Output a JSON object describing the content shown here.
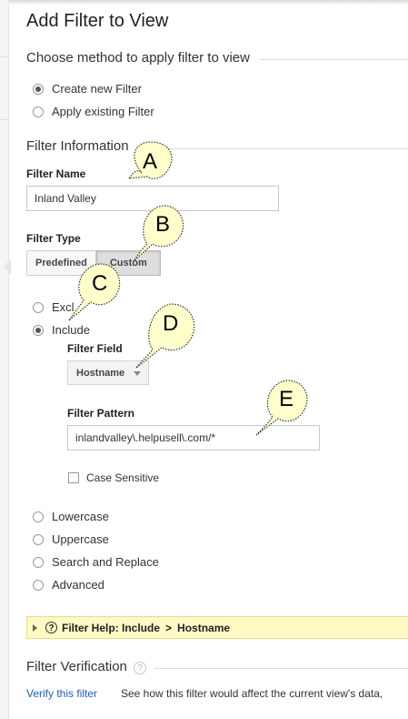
{
  "page": {
    "title": "Add Filter to View"
  },
  "method": {
    "heading": "Choose method to apply filter to view",
    "options": [
      {
        "label": "Create new Filter",
        "selected": true
      },
      {
        "label": "Apply existing Filter",
        "selected": false
      }
    ]
  },
  "filter_info": {
    "heading": "Filter Information",
    "name_label": "Filter Name",
    "name_value": "Inland Valley",
    "type_label": "Filter Type",
    "type_buttons": [
      {
        "label": "Predefined",
        "active": false
      },
      {
        "label": "Custom",
        "active": true
      }
    ]
  },
  "custom": {
    "exclude_label": "Excl",
    "include_label": "Include",
    "field_label": "Filter Field",
    "field_value": "Hostname",
    "pattern_label": "Filter Pattern",
    "pattern_value": "inlandvalley\\.helpusell\\.com/*",
    "case_label": "Case Sensitive",
    "other_options": [
      "Lowercase",
      "Uppercase",
      "Search and Replace",
      "Advanced"
    ]
  },
  "help": {
    "icon": "?",
    "text": "Filter Help: Include",
    "separator": ">",
    "field": "Hostname"
  },
  "verification": {
    "heading": "Filter Verification",
    "help_icon": "?",
    "link": "Verify this filter",
    "description": "See how this filter would affect the current view's data,"
  },
  "callouts": [
    "A",
    "B",
    "C",
    "D",
    "E"
  ]
}
